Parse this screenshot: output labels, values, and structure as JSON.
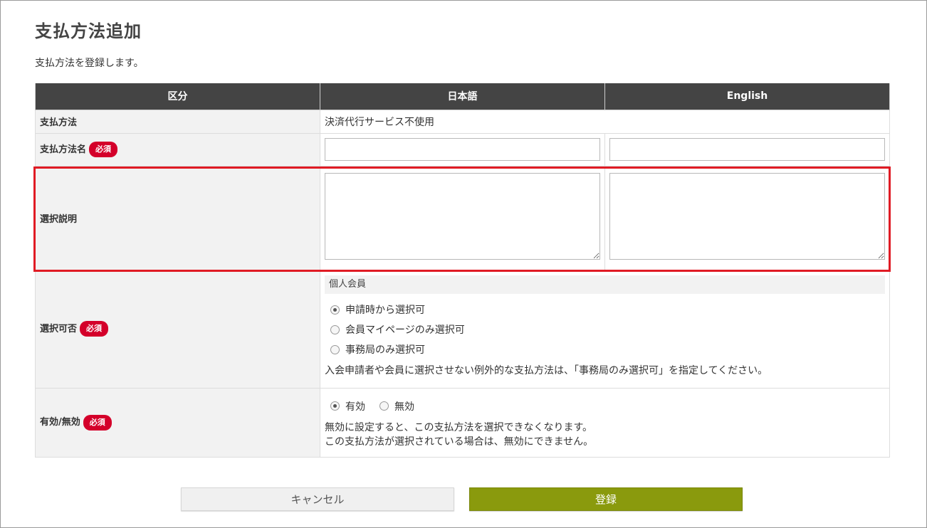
{
  "page": {
    "title": "支払方法追加",
    "description": "支払方法を登録します。"
  },
  "table": {
    "headers": {
      "category": "区分",
      "japanese": "日本語",
      "english": "English"
    },
    "required_badge": "必須",
    "rows": {
      "payment_method": {
        "label": "支払方法",
        "value": "決済代行サービス不使用"
      },
      "payment_method_name": {
        "label": "支払方法名",
        "ja_value": "",
        "en_value": ""
      },
      "selection_description": {
        "label": "選択説明",
        "ja_value": "",
        "en_value": ""
      },
      "selectability": {
        "label": "選択可否",
        "group_label": "個人会員",
        "options": [
          {
            "label": "申請時から選択可",
            "checked": true
          },
          {
            "label": "会員マイページのみ選択可",
            "checked": false
          },
          {
            "label": "事務局のみ選択可",
            "checked": false
          }
        ],
        "note": "入会申請者や会員に選択させない例外的な支払方法は、「事務局のみ選択可」を指定してください。"
      },
      "enabled": {
        "label": "有効/無効",
        "options": [
          {
            "label": "有効",
            "checked": true
          },
          {
            "label": "無効",
            "checked": false
          }
        ],
        "note_line1": "無効に設定すると、この支払方法を選択できなくなります。",
        "note_line2": "この支払方法が選択されている場合は、無効にできません。"
      }
    }
  },
  "buttons": {
    "cancel": "キャンセル",
    "submit": "登録"
  },
  "colors": {
    "header_bg": "#444444",
    "required_badge": "#d4002a",
    "submit_button": "#8a9a0d",
    "highlight_border": "#e01b24"
  }
}
